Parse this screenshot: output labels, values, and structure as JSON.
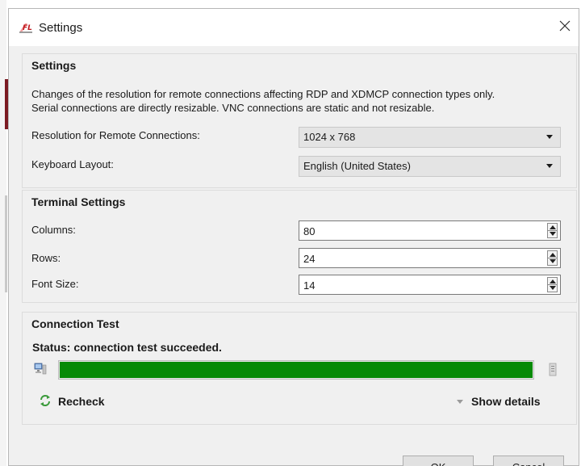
{
  "window": {
    "title": "Settings",
    "app_icon": "fl-app-icon",
    "close_glyph": "✕"
  },
  "settings_group": {
    "title": "Settings",
    "description_line1": "Changes of the resolution for remote connections affecting RDP and XDMCP connection types only.",
    "description_line2": "Serial connections are directly resizable. VNC connections are static and not resizable.",
    "resolution_label": "Resolution for Remote Connections:",
    "resolution_value": "1024 x 768",
    "keyboard_label": "Keyboard Layout:",
    "keyboard_value": "English (United States)"
  },
  "terminal_group": {
    "title": "Terminal Settings",
    "columns_label": "Columns:",
    "columns_value": "80",
    "rows_label": "Rows:",
    "rows_value": "24",
    "font_size_label": "Font Size:",
    "font_size_value": "14"
  },
  "connection_group": {
    "title": "Connection Test",
    "status": "Status:  connection test succeeded.",
    "progress": 1.0,
    "progress_color": "#078a07",
    "recheck_label": "Recheck",
    "show_details_label": "Show details"
  },
  "buttons": {
    "ok": "OK",
    "cancel": "Cancel"
  }
}
